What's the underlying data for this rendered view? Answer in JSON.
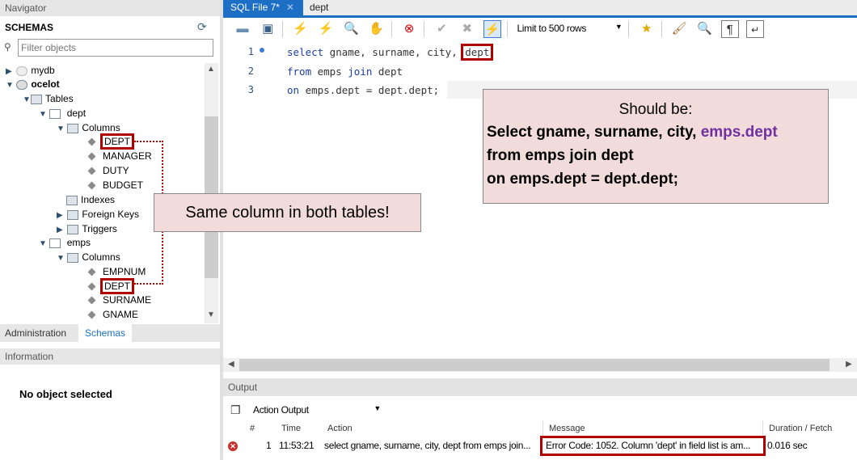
{
  "navigator": {
    "title": "Navigator",
    "schemas_label": "SCHEMAS",
    "filter_placeholder": "Filter objects",
    "tree": {
      "mydb": "mydb",
      "ocelot": "ocelot",
      "tables": "Tables",
      "dept": "dept",
      "dept_columns": "Columns",
      "dept_cols": [
        "DEPT",
        "MANAGER",
        "DUTY",
        "BUDGET"
      ],
      "indexes": "Indexes",
      "foreign_keys": "Foreign Keys",
      "triggers": "Triggers",
      "emps": "emps",
      "emps_columns": "Columns",
      "emps_cols": [
        "EMPNUM",
        "DEPT",
        "SURNAME",
        "GNAME"
      ]
    },
    "tabs": [
      "Administration",
      "Schemas"
    ],
    "active_tab": "Schemas"
  },
  "information": {
    "title": "Information",
    "message": "No object selected"
  },
  "editor": {
    "tabs": [
      {
        "label": "SQL File 7*",
        "active": true
      },
      {
        "label": "dept",
        "active": false
      }
    ],
    "limit_select": "Limit to 500 rows",
    "lines": [
      {
        "n": "1",
        "parts": [
          [
            "kw",
            "select"
          ],
          [
            "id",
            " gname, surname, city, "
          ],
          [
            "hl",
            "dept"
          ]
        ]
      },
      {
        "n": "2",
        "parts": [
          [
            "kw",
            "from"
          ],
          [
            "id",
            " emps "
          ],
          [
            "kw",
            "join"
          ],
          [
            "id",
            " dept"
          ]
        ]
      },
      {
        "n": "3",
        "parts": [
          [
            "kw",
            "on"
          ],
          [
            "id",
            " emps.dept = dept.dept;"
          ]
        ]
      }
    ]
  },
  "callouts": {
    "correction_title": "Should be:",
    "correction_line1_a": "Select gname, surname, city, ",
    "correction_line1_b": "emps.dept",
    "correction_line2": "from emps join dept",
    "correction_line3": "on emps.dept = dept.dept;",
    "same_column": "Same column in both tables!"
  },
  "output": {
    "title": "Output",
    "mode": "Action Output",
    "columns": [
      "#",
      "Time",
      "Action",
      "Message",
      "Duration / Fetch"
    ],
    "rows": [
      {
        "status": "error",
        "num": "1",
        "time": "11:53:21",
        "action": "select gname, surname, city, dept from emps join...",
        "message": "Error Code: 1052. Column 'dept' in field list is am...",
        "duration": "0.016 sec"
      }
    ]
  },
  "colors": {
    "accent": "#1c6fc4",
    "highlight": "#b00000",
    "callout_bg": "#f2dcdb",
    "purple": "#7030a0"
  }
}
